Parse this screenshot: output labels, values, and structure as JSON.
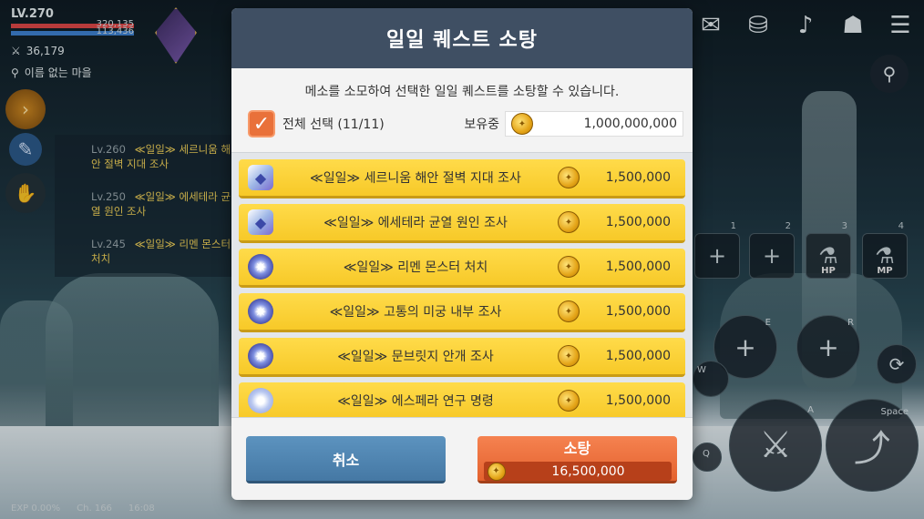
{
  "hud": {
    "level": "LV.270",
    "hp": "320,135",
    "mp": "113,436",
    "combat_power": "36,179",
    "map_name": "이름 없는 마을",
    "exp": "EXP  0.00%",
    "channel": "Ch. 166",
    "time": "16:08"
  },
  "side_quests": [
    {
      "level": "Lv.260",
      "title": "≪일일≫ 세르니움 해안 절벽 지대 조사"
    },
    {
      "level": "Lv.250",
      "title": "≪일일≫ 에세테라 균열 원인 조사"
    },
    {
      "level": "Lv.245",
      "title": "≪일일≫ 리멘 몬스터 처치"
    }
  ],
  "skill_keys": {
    "s1": "1",
    "s2": "2",
    "s3": "3",
    "s4": "4",
    "hp": "HP",
    "mp": "MP",
    "e": "E",
    "r": "R",
    "w": "W",
    "q": "Q",
    "a": "A",
    "space": "Space"
  },
  "dialog": {
    "title": "일일 퀘스트 소탕",
    "description": "메소를 소모하여 선택한 일일 퀘스트를 소탕할 수 있습니다.",
    "select_all": "전체 선택 (11/11)",
    "holding_label": "보유중",
    "holding_value": "1,000,000,000",
    "quests": [
      {
        "name": "≪일일≫ 세르니움 해안 절벽 지대 조사",
        "cost": "1,500,000"
      },
      {
        "name": "≪일일≫ 에세테라 균열 원인 조사",
        "cost": "1,500,000"
      },
      {
        "name": "≪일일≫ 리멘 몬스터 처치",
        "cost": "1,500,000"
      },
      {
        "name": "≪일일≫ 고통의 미궁 내부 조사",
        "cost": "1,500,000"
      },
      {
        "name": "≪일일≫ 문브릿지 안개 조사",
        "cost": "1,500,000"
      },
      {
        "name": "≪일일≫ 에스페라 연구 명령",
        "cost": "1,500,000"
      }
    ],
    "cancel_label": "취소",
    "sweep_label": "소탕",
    "total_cost": "16,500,000"
  },
  "colors": {
    "header": "#3f4f63",
    "row": "#f7c928",
    "cancel": "#4578a4",
    "sweep": "#e4622e",
    "checkbox": "#e9713a"
  }
}
